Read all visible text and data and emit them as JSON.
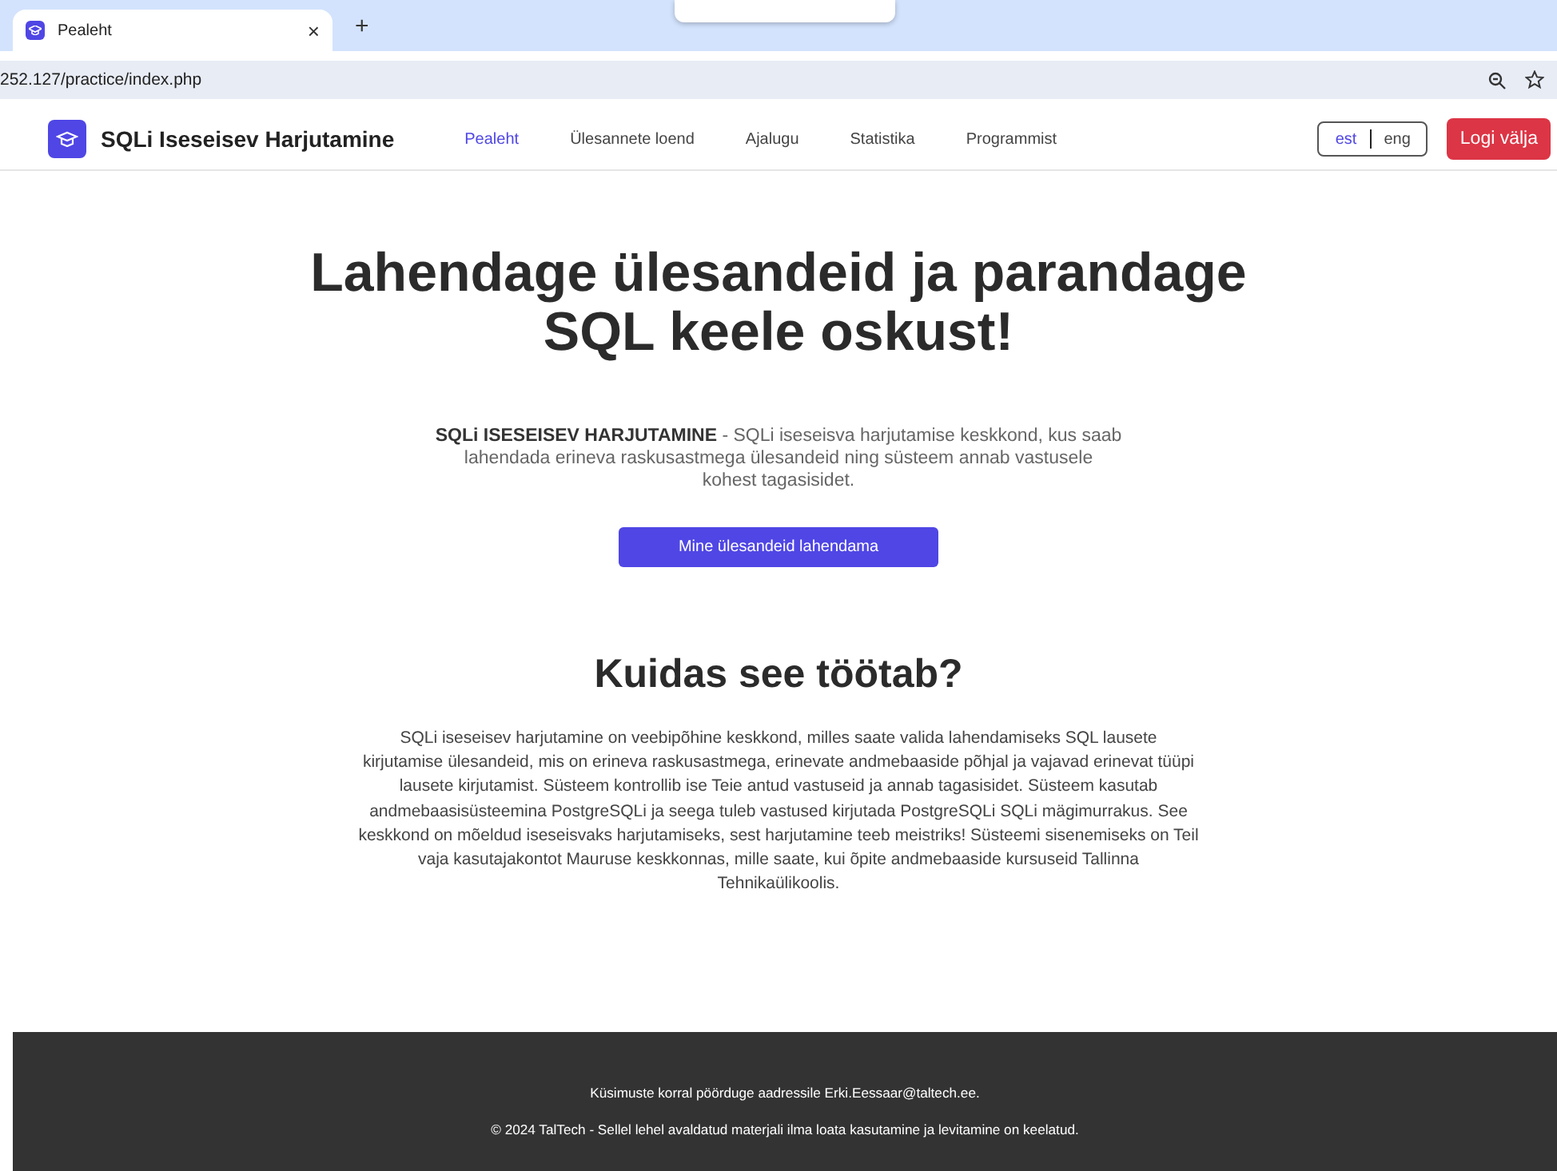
{
  "browser": {
    "tab": {
      "title": "Pealeht",
      "close": "×"
    },
    "new_tab": "+",
    "address": "252.127/practice/index.php"
  },
  "navbar": {
    "brand": "SQLi Iseseisev Harjutamine",
    "links": [
      {
        "label": "Pealeht",
        "selected": true
      },
      {
        "label": "Ülesannete loend",
        "selected": false
      },
      {
        "label": "Ajalugu",
        "selected": false
      },
      {
        "label": "Statistika",
        "selected": false
      },
      {
        "label": "Programmist",
        "selected": false
      }
    ],
    "languages": [
      {
        "label": "est",
        "selected": true
      },
      {
        "label": "eng",
        "selected": false
      }
    ],
    "logout": "Logi välja"
  },
  "hero": {
    "heading": "Lahendage ülesandeid ja parandage SQL keele oskust!",
    "description": "**SQLi ISESEISEV HARJUTAMINE** - SQLi iseseisva harjutamise keskkond, kus saab lahendada erineva raskusastmega ülesandeid ning süsteem annab vastusele kohest tagasisidet.",
    "button": "Mine ülesandeid lahendama"
  },
  "about": {
    "heading": "Kuidas see töötab?",
    "text": "SQLi iseseisev harjutamine on veebipõhine keskkond, milles saate valida lahendamiseks SQL lausete kirjutamise ülesandeid, mis on erineva raskusastmega, erinevate andmebaaside põhjal ja vajavad erinevat tüüpi lausete kirjutamist. Süsteem kontrollib ise Teie antud vastuseid ja annab tagasisidet. Süsteem kasutab andmebaasisüsteemina PostgreSQLi ja seega tuleb vastused kirjutada PostgreSQLi SQLi mägimurrakus. See keskkond on mõeldud iseseisvaks harjutamiseks, sest harjutamine teeb meistriks! Süsteemi sisenemiseks on Teil vaja kasutajakontot Mauruse keskkonnas, mille saate, kui õpite andmebaaside kursuseid Tallinna Tehnikaülikoolis."
  },
  "footer": {
    "contact": "Küsimuste korral pöörduge aadressile Erki.Eessaar@taltech.ee.",
    "copyright": "© 2024 TalTech - Sellel lehel avaldatud materjali ilma loata kasutamine ja levitamine on keelatud."
  }
}
